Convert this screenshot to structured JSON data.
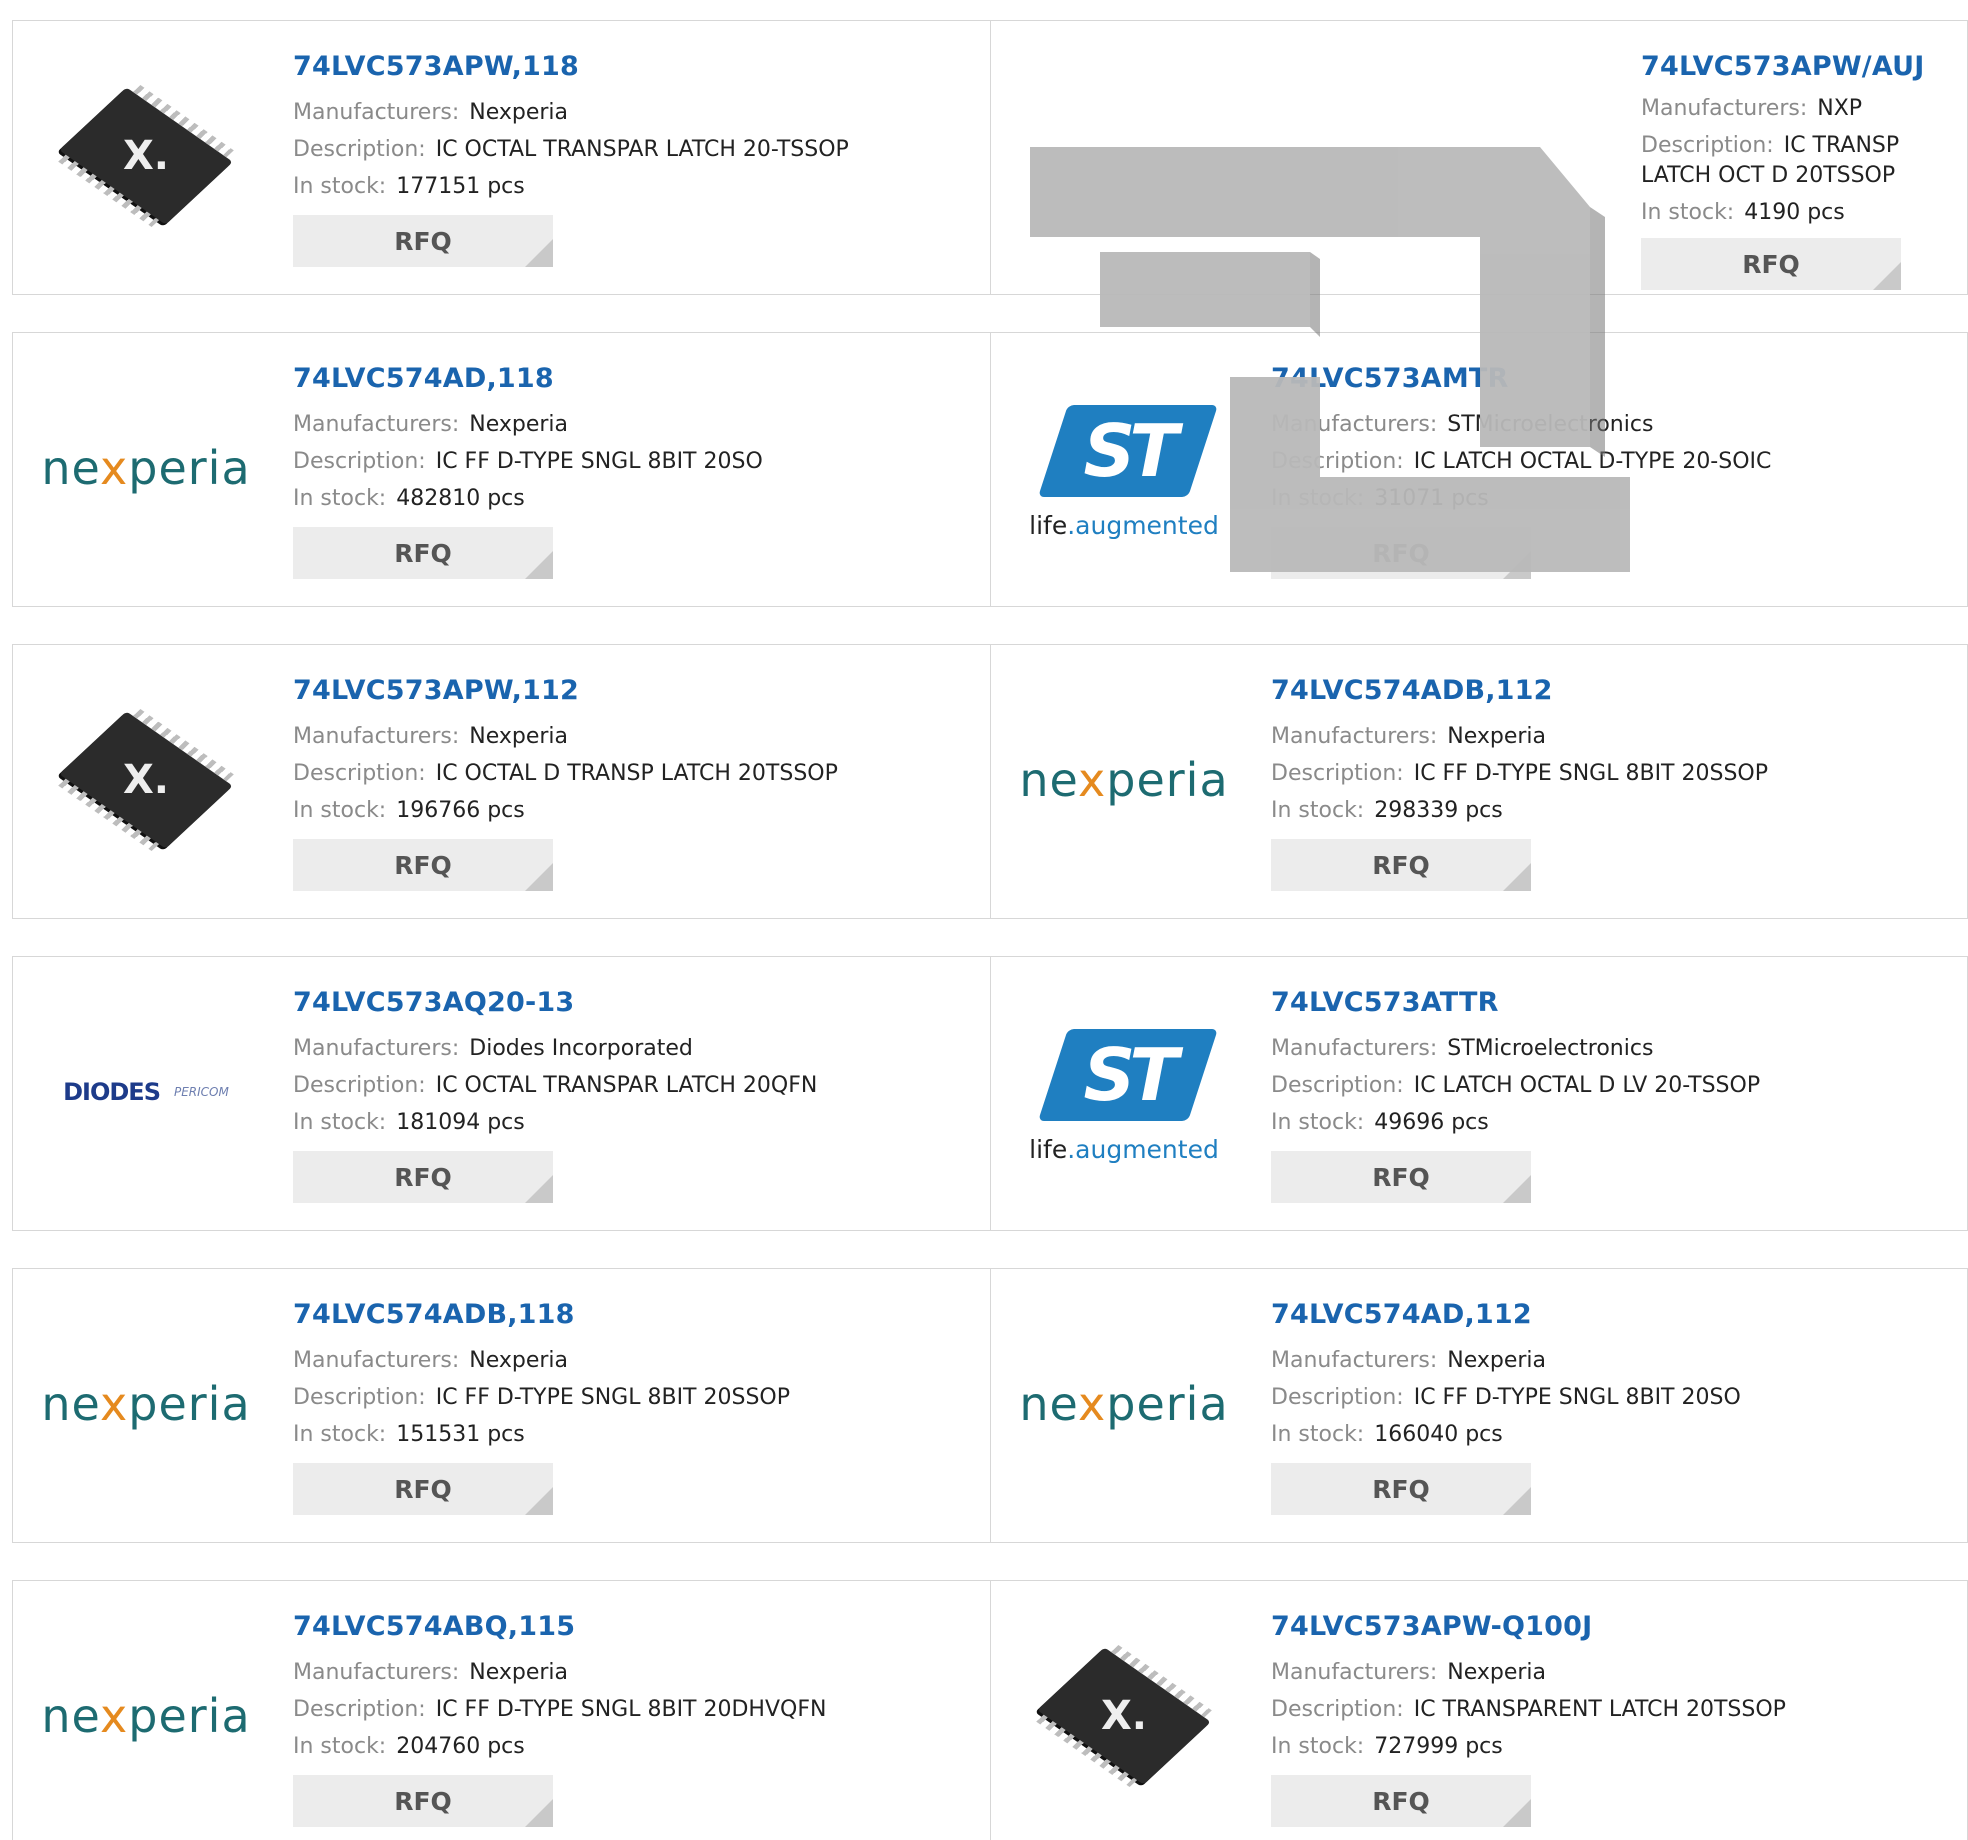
{
  "labels": {
    "manufacturer": "Manufacturers:",
    "description": "Description:",
    "stock": "In stock:",
    "rfq": "RFQ"
  },
  "logos": {
    "nexperia": [
      "ne",
      "x",
      "peria"
    ],
    "st_tagline": [
      "life",
      ".augmented"
    ],
    "diodes": "DIODES",
    "pericom": "PERICOM",
    "chip_glyph": "X."
  },
  "products": [
    {
      "part": "74LVC573APW,118",
      "manufacturer": "Nexperia",
      "description": "IC OCTAL TRANSPAR LATCH 20-TSSOP",
      "stock": "177151 pcs",
      "logo": "chip-icon"
    },
    {
      "part": "74LVC573APW/AUJ",
      "manufacturer": "NXP",
      "description": "IC TRANSP LATCH OCT D 20TSSOP",
      "stock": "4190 pcs",
      "logo": "none"
    },
    {
      "part": "74LVC574AD,118",
      "manufacturer": "Nexperia",
      "description": "IC FF D-TYPE SNGL 8BIT 20SO",
      "stock": "482810 pcs",
      "logo": "nexperia-logo"
    },
    {
      "part": "74LVC573AMTR",
      "manufacturer": "STMicroelectronics",
      "description": "IC LATCH OCTAL D-TYPE 20-SOIC",
      "stock": "31071 pcs",
      "logo": "st-logo"
    },
    {
      "part": "74LVC573APW,112",
      "manufacturer": "Nexperia",
      "description": "IC OCTAL D TRANSP LATCH 20TSSOP",
      "stock": "196766 pcs",
      "logo": "chip-icon"
    },
    {
      "part": "74LVC574ADB,112",
      "manufacturer": "Nexperia",
      "description": "IC FF D-TYPE SNGL 8BIT 20SSOP",
      "stock": "298339 pcs",
      "logo": "nexperia-logo"
    },
    {
      "part": "74LVC573AQ20-13",
      "manufacturer": "Diodes Incorporated",
      "description": "IC OCTAL TRANSPAR LATCH 20QFN",
      "stock": "181094 pcs",
      "logo": "diodes-logo"
    },
    {
      "part": "74LVC573ATTR",
      "manufacturer": "STMicroelectronics",
      "description": "IC LATCH OCTAL D LV 20-TSSOP",
      "stock": "49696 pcs",
      "logo": "st-logo"
    },
    {
      "part": "74LVC574ADB,118",
      "manufacturer": "Nexperia",
      "description": "IC FF D-TYPE SNGL 8BIT 20SSOP",
      "stock": "151531 pcs",
      "logo": "nexperia-logo"
    },
    {
      "part": "74LVC574AD,112",
      "manufacturer": "Nexperia",
      "description": "IC FF D-TYPE SNGL 8BIT 20SO",
      "stock": "166040 pcs",
      "logo": "nexperia-logo"
    },
    {
      "part": "74LVC574ABQ,115",
      "manufacturer": "Nexperia",
      "description": "IC FF D-TYPE SNGL 8BIT 20DHVQFN",
      "stock": "204760 pcs",
      "logo": "nexperia-logo"
    },
    {
      "part": "74LVC573APW-Q100J",
      "manufacturer": "Nexperia",
      "description": "IC TRANSPARENT LATCH 20TSSOP",
      "stock": "727999 pcs",
      "logo": "chip-icon"
    }
  ],
  "colors": {
    "link": "#1a64ae",
    "label": "#8a8a8a",
    "button": "#ececec",
    "nexperia_teal": "#1d6b71",
    "nexperia_orange": "#e58a1f",
    "st_blue": "#1f7fc1"
  }
}
